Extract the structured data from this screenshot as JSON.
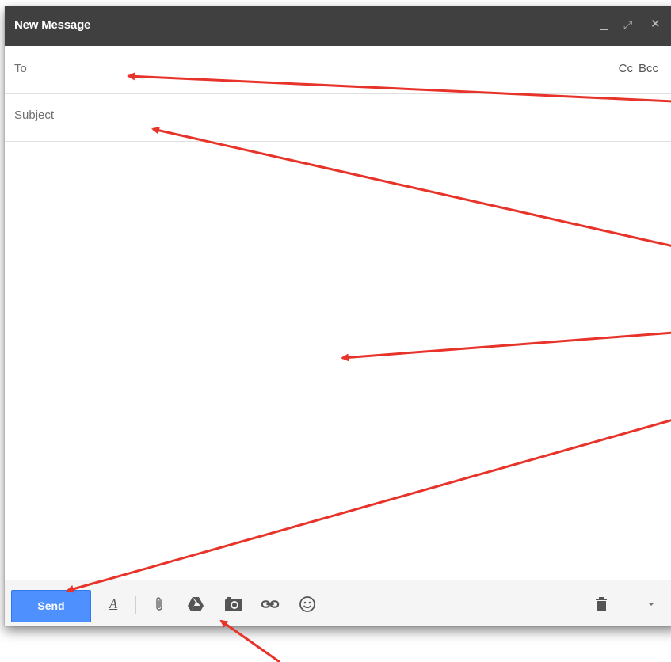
{
  "window": {
    "title": "New Message",
    "controls": {
      "minimize": "_",
      "expand": "⤢",
      "close": "✕"
    }
  },
  "fields": {
    "to_label": "To",
    "cc_label": "Cc",
    "bcc_label": "Bcc",
    "subject_label": "Subject",
    "body_value": ""
  },
  "toolbar": {
    "send_label": "Send",
    "icons": [
      "format-text-icon",
      "attach-icon",
      "drive-icon",
      "photo-icon",
      "link-icon",
      "emoji-icon",
      "trash-icon",
      "more-options-icon"
    ]
  },
  "colors": {
    "titlebar": "#404040",
    "send_button": "#4d90fe",
    "annotation_arrows": "#e8332a"
  }
}
